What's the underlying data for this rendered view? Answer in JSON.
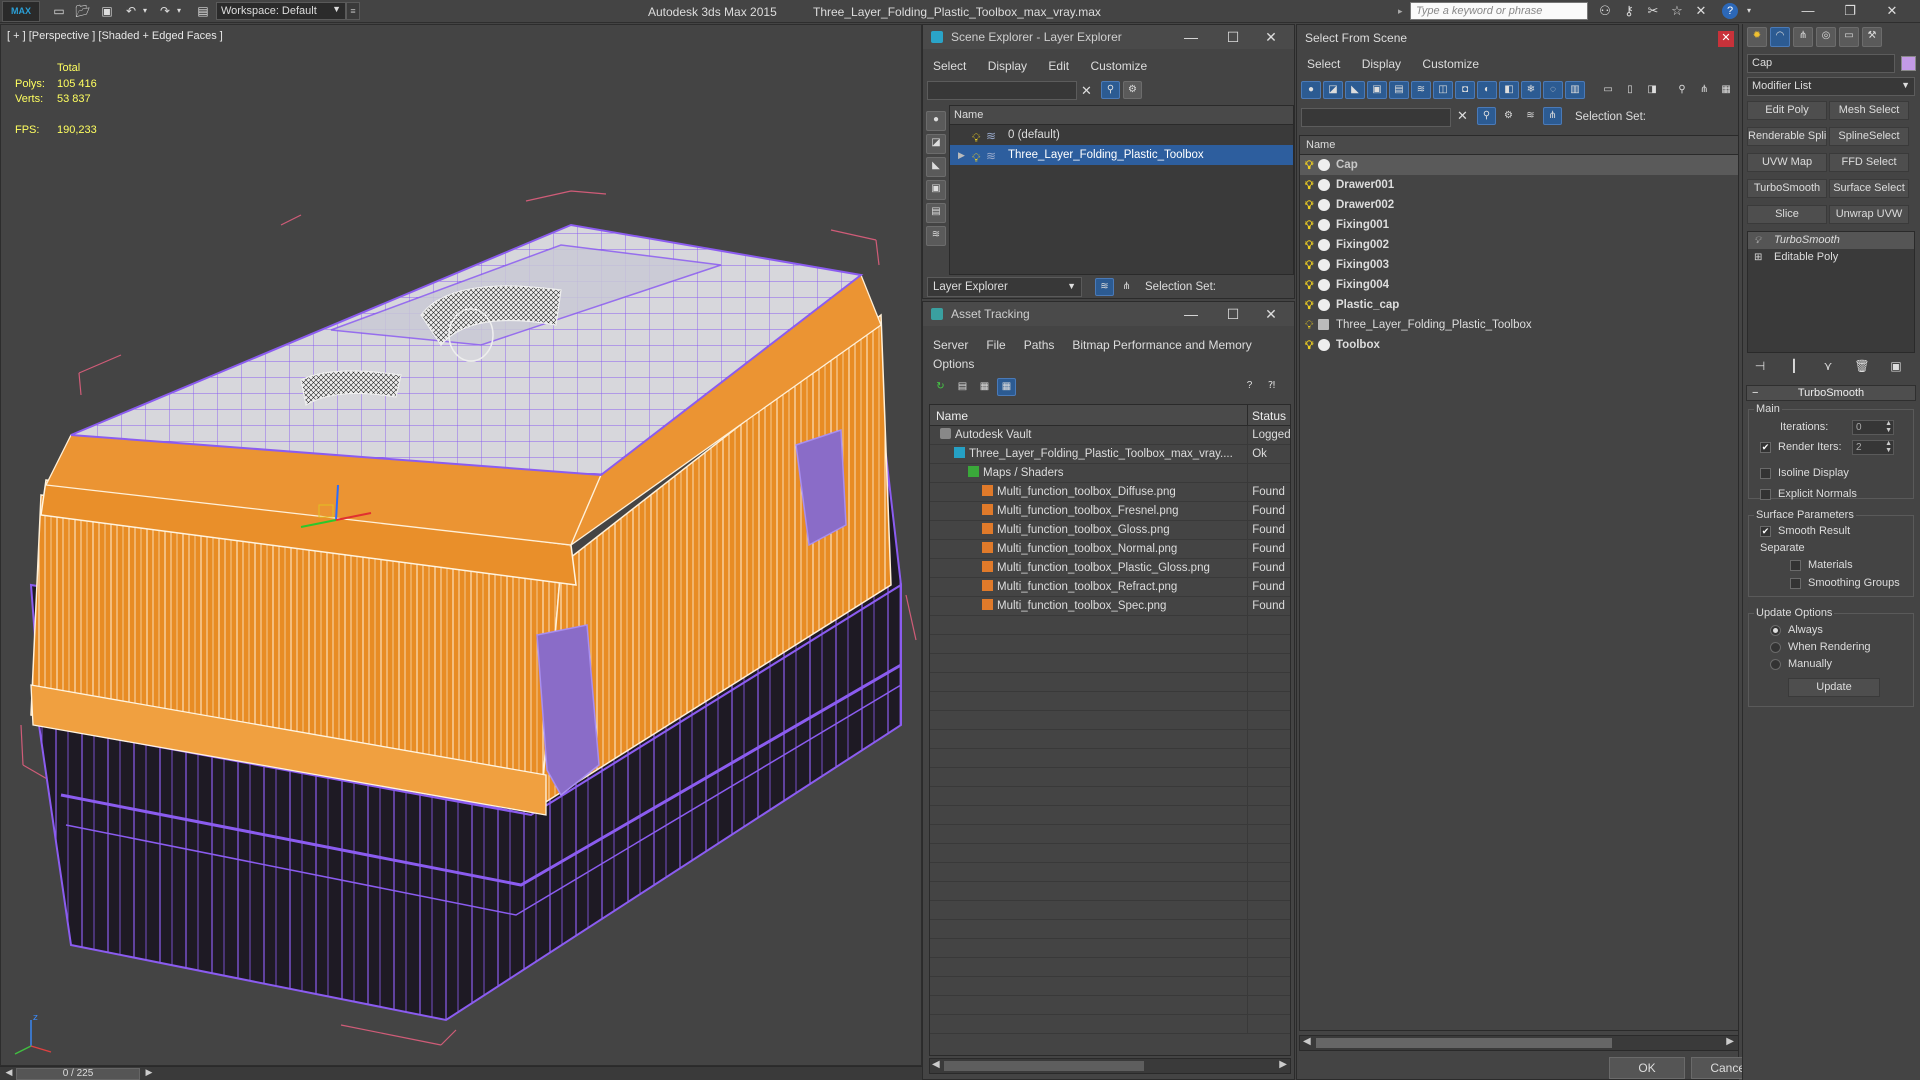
{
  "titlebar": {
    "logo_text": "MAX",
    "workspace_label": "Workspace: Default",
    "app_title": "Autodesk 3ds Max  2015",
    "file_title": "Three_Layer_Folding_Plastic_Toolbox_max_vray.max",
    "search_placeholder": "Type a keyword or phrase",
    "quick_access_icons": [
      "new-file-icon",
      "open-file-icon",
      "save-icon",
      "undo-icon",
      "redo-icon"
    ]
  },
  "viewport": {
    "label": "[ + ] [Perspective ] [Shaded + Edged Faces ]",
    "stats": {
      "total_label": "Total",
      "polys_label": "Polys:",
      "polys_value": "105 416",
      "verts_label": "Verts:",
      "verts_value": "53 837",
      "fps_label": "FPS:",
      "fps_value": "190,233"
    },
    "colors": {
      "orange_shell": "#e88c24",
      "wire_purple": "#8b5cf0",
      "dark_body": "#1d1a22",
      "bbox_pink": "#d05c78"
    }
  },
  "time_slider": {
    "value": "0 / 225"
  },
  "scene_explorer": {
    "title": "Scene Explorer - Layer Explorer",
    "menu": [
      "Select",
      "Display",
      "Edit",
      "Customize"
    ],
    "column_name": "Name",
    "rows": [
      {
        "name": "0 (default)",
        "selected": false
      },
      {
        "name": "Three_Layer_Folding_Plastic_Toolbox",
        "selected": true
      }
    ],
    "layer_combo": "Layer Explorer",
    "selection_set_label": "Selection Set:"
  },
  "asset_tracking": {
    "title": "Asset Tracking",
    "menu_line1": [
      "Server",
      "File",
      "Paths",
      "Bitmap Performance and Memory"
    ],
    "menu_line2": [
      "Options"
    ],
    "col_name": "Name",
    "col_status": "Status",
    "rows": [
      {
        "indent": 1,
        "icon": "vault",
        "name": "Autodesk Vault",
        "status": "Logged"
      },
      {
        "indent": 2,
        "icon": "maxf",
        "name": "Three_Layer_Folding_Plastic_Toolbox_max_vray....",
        "status": "Ok"
      },
      {
        "indent": 3,
        "icon": "folder",
        "name": "Maps / Shaders",
        "status": ""
      },
      {
        "indent": 4,
        "icon": "png",
        "name": "Multi_function_toolbox_Diffuse.png",
        "status": "Found"
      },
      {
        "indent": 4,
        "icon": "png",
        "name": "Multi_function_toolbox_Fresnel.png",
        "status": "Found"
      },
      {
        "indent": 4,
        "icon": "png",
        "name": "Multi_function_toolbox_Gloss.png",
        "status": "Found"
      },
      {
        "indent": 4,
        "icon": "png",
        "name": "Multi_function_toolbox_Normal.png",
        "status": "Found"
      },
      {
        "indent": 4,
        "icon": "png",
        "name": "Multi_function_toolbox_Plastic_Gloss.png",
        "status": "Found"
      },
      {
        "indent": 4,
        "icon": "png",
        "name": "Multi_function_toolbox_Refract.png",
        "status": "Found"
      },
      {
        "indent": 4,
        "icon": "png",
        "name": "Multi_function_toolbox_Spec.png",
        "status": "Found"
      }
    ]
  },
  "select_from_scene": {
    "title": "Select From Scene",
    "menu": [
      "Select",
      "Display",
      "Customize"
    ],
    "selection_set_label": "Selection Set:",
    "column_name": "Name",
    "objects": [
      {
        "name": "Cap",
        "selected": true,
        "group": false
      },
      {
        "name": "Drawer001",
        "selected": false,
        "group": false
      },
      {
        "name": "Drawer002",
        "selected": false,
        "group": false
      },
      {
        "name": "Fixing001",
        "selected": false,
        "group": false
      },
      {
        "name": "Fixing002",
        "selected": false,
        "group": false
      },
      {
        "name": "Fixing003",
        "selected": false,
        "group": false
      },
      {
        "name": "Fixing004",
        "selected": false,
        "group": false
      },
      {
        "name": "Plastic_cap",
        "selected": false,
        "group": false
      },
      {
        "name": "Three_Layer_Folding_Plastic_Toolbox",
        "selected": false,
        "group": true
      },
      {
        "name": "Toolbox",
        "selected": false,
        "group": false
      }
    ],
    "ok_label": "OK",
    "cancel_label": "Cancel"
  },
  "command_panel": {
    "object_name": "Cap",
    "object_color": "#c39ae6",
    "modifier_list": "Modifier List",
    "modifier_buttons": [
      "Edit Poly",
      "Mesh Select",
      "Renderable Spline",
      "SplineSelect",
      "UVW Map",
      "FFD Select",
      "TurboSmooth",
      "Surface Select",
      "Slice",
      "Unwrap UVW"
    ],
    "stack": [
      {
        "name": "TurboSmooth",
        "selected": true
      },
      {
        "name": "Editable Poly",
        "selected": false
      }
    ],
    "rollout": {
      "title": "TurboSmooth",
      "main_label": "Main",
      "iterations_label": "Iterations:",
      "iterations_value": "0",
      "render_iters_label": "Render Iters:",
      "render_iters_value": "2",
      "isoline_label": "Isoline Display",
      "explicit_normals_label": "Explicit Normals",
      "surface_params_label": "Surface Parameters",
      "smooth_result_label": "Smooth Result",
      "separate_label": "Separate",
      "materials_label": "Materials",
      "smoothing_groups_label": "Smoothing Groups",
      "update_options_label": "Update Options",
      "always_label": "Always",
      "when_rendering_label": "When Rendering",
      "manually_label": "Manually",
      "update_button": "Update"
    }
  }
}
